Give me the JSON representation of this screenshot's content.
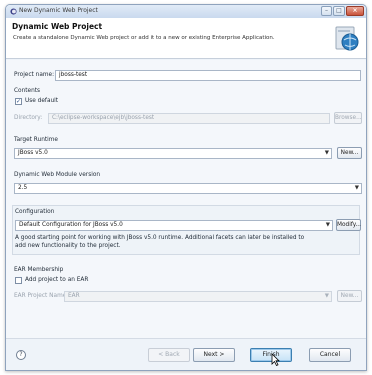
{
  "window": {
    "title": "New Dynamic Web Project"
  },
  "banner": {
    "heading": "Dynamic Web Project",
    "description": "Create a standalone Dynamic Web project or add it to a new or existing Enterprise Application."
  },
  "project": {
    "name_label": "Project name:",
    "name_value": "jboss-test"
  },
  "contents": {
    "label": "Contents",
    "use_default_label": "Use default",
    "use_default_checked": true,
    "directory_label": "Directory:",
    "directory_value": "C:\\eclipse-workspace\\ejb\\jboss-test",
    "browse_label": "Browse..."
  },
  "target_runtime": {
    "label": "Target Runtime",
    "value": "JBoss v5.0",
    "new_label": "New..."
  },
  "module_version": {
    "label": "Dynamic Web Module version",
    "value": "2.5"
  },
  "configuration": {
    "label": "Configuration",
    "value": "Default Configuration for JBoss v5.0",
    "modify_label": "Modify...",
    "description_line1": "A good starting point for working with JBoss v5.0 runtime. Additional facets can later be installed to",
    "description_line2": "add new functionality to the project."
  },
  "ear": {
    "label": "EAR Membership",
    "add_label": "Add project to an EAR",
    "add_checked": false,
    "project_name_label": "EAR Project Name:",
    "project_name_value": "EAR",
    "new_label": "New..."
  },
  "footer": {
    "help_symbol": "?",
    "back_label": "< Back",
    "next_label": "Next >",
    "finish_label": "Finish",
    "cancel_label": "Cancel"
  },
  "colors": {
    "accent": "#3c7fb1",
    "border": "#a9b6c7"
  }
}
